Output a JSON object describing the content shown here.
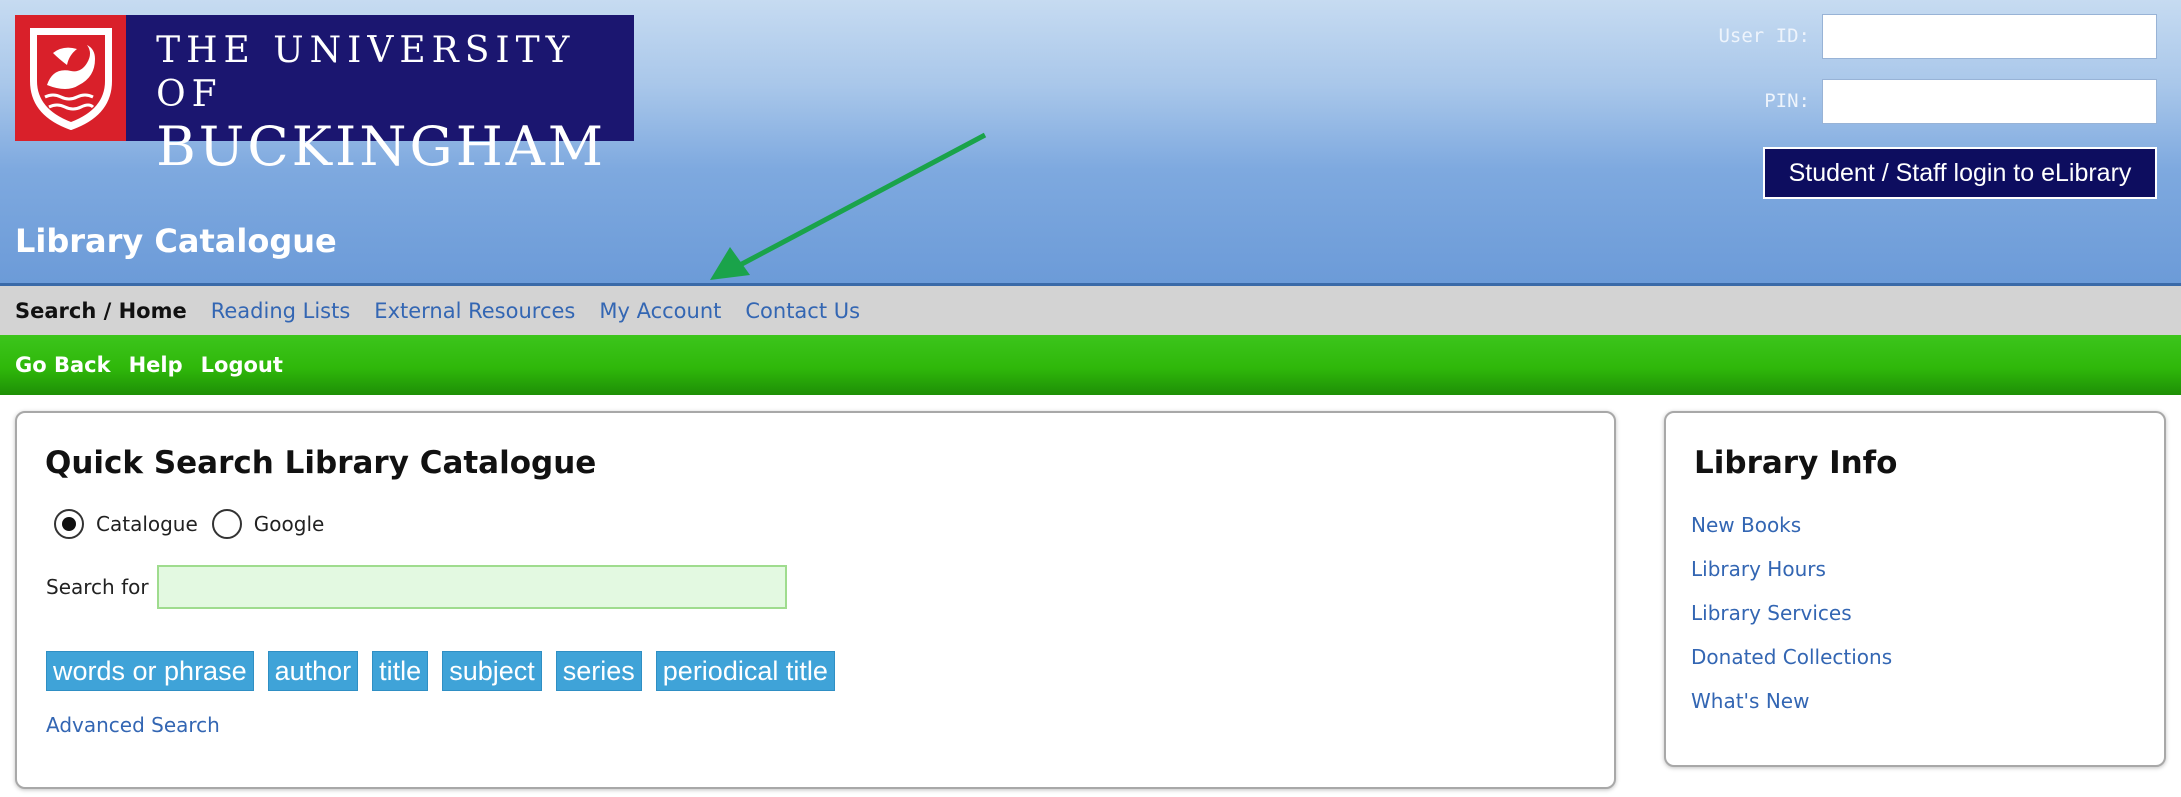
{
  "logo": {
    "line1": "THE UNIVERSITY OF",
    "line2": "BUCKINGHAM",
    "crest_icon": "swan-crest-icon",
    "colors": {
      "navy": "#1b1670",
      "crest_red": "#d9202a"
    }
  },
  "login": {
    "user_id_label": "User ID:",
    "pin_label": "PIN:",
    "user_id_value": "",
    "pin_value": "",
    "button_label": "Student / Staff login to eLibrary"
  },
  "page_heading": "Library Catalogue",
  "nav": {
    "items": [
      {
        "label": "Search / Home",
        "current": true
      },
      {
        "label": "Reading Lists"
      },
      {
        "label": "External Resources"
      },
      {
        "label": "My Account"
      },
      {
        "label": "Contact Us"
      }
    ]
  },
  "subnav": {
    "items": [
      {
        "label": "Go Back"
      },
      {
        "label": "Help"
      },
      {
        "label": "Logout"
      }
    ]
  },
  "quick_search": {
    "title": "Quick Search Library Catalogue",
    "radio_options": [
      {
        "label": "Catalogue",
        "selected": true
      },
      {
        "label": "Google",
        "selected": false
      }
    ],
    "search_label": "Search for",
    "search_value": "",
    "buttons": [
      {
        "label": "words or phrase"
      },
      {
        "label": "author"
      },
      {
        "label": "title"
      },
      {
        "label": "subject"
      },
      {
        "label": "series"
      },
      {
        "label": "periodical title"
      }
    ],
    "advanced_link": "Advanced Search"
  },
  "library_info": {
    "title": "Library Info",
    "links": [
      {
        "label": "New Books"
      },
      {
        "label": "Library Hours"
      },
      {
        "label": "Library Services"
      },
      {
        "label": "Donated Collections"
      },
      {
        "label": "What's New"
      }
    ]
  },
  "annotation": {
    "arrow_icon": "green-arrow-icon",
    "color": "#1aa34a"
  },
  "colors": {
    "link": "#3366b3",
    "nav_bg": "#d3d3d3",
    "subnav_green": "#2fb80a",
    "button_blue": "#3fa3d8",
    "login_button": "#0d0d5f"
  }
}
